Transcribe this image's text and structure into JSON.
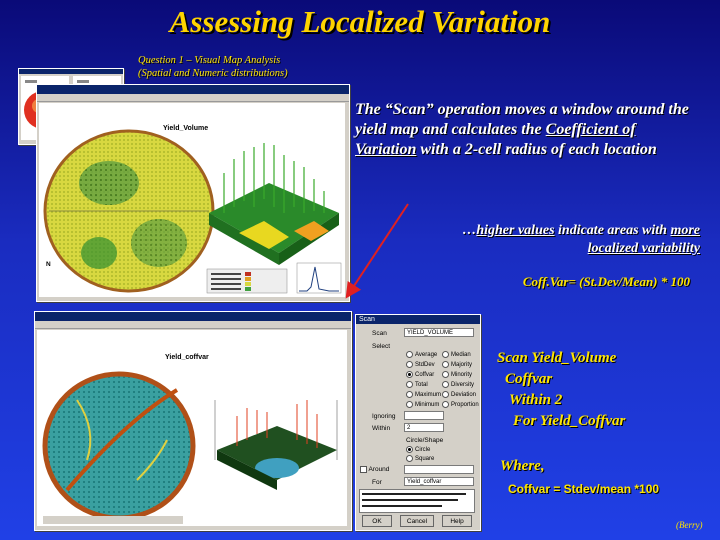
{
  "title": "Assessing Localized Variation",
  "subtitle": {
    "line1": "Question 1 – Visual Map Analysis",
    "line2": "(Spatial and Numeric distributions)"
  },
  "description": {
    "part1": "The “Scan” operation moves a window around the yield map and calculates the ",
    "cv": "Coefficient of Variation",
    "part2": " with a 2-cell radius of each location"
  },
  "note": {
    "prefix": "…",
    "higher": "higher values",
    "mid": " indicate areas with ",
    "more": "more localized variability"
  },
  "formula": "Coff.Var= (St.Dev/Mean) * 100",
  "command": {
    "line1": "Scan Yield_Volume",
    "line2": "Coffvar",
    "line3": "Within 2",
    "line4": "For Yield_Coffvar"
  },
  "where_label": "Where,",
  "where_def": "Coffvar = Stdev/mean *100",
  "credit": "(Berry)",
  "top_window": {
    "map_label": "Yield_Volume",
    "north": "N"
  },
  "bottom_window": {
    "map_label": "Yield_coffvar"
  },
  "scan_dialog": {
    "title": "Scan",
    "source_label": "Scan",
    "source_value": "YIELD_VOLUME",
    "select_label": "Select",
    "options_col1": [
      "Average",
      "StdDev",
      "Coffvar",
      "Total",
      "Maximum",
      "Minimum"
    ],
    "options_col2": [
      "Median",
      "Majority",
      "Minority",
      "Diversity",
      "Deviation",
      "Proportion"
    ],
    "selected_option": "Coffvar",
    "ignoring_label": "Ignoring",
    "within_label": "Within",
    "within_value": "2",
    "shape_label": "Circle/Shape",
    "shape_options": [
      "Circle",
      "Square"
    ],
    "around_label": "Around",
    "for_label": "For",
    "for_value": "Yield_coffvar",
    "ok": "OK",
    "cancel": "Cancel",
    "help": "Help"
  },
  "colors": {
    "title": "#ffd400",
    "accent_text": "#ffe600",
    "arrow": "#e02020"
  }
}
